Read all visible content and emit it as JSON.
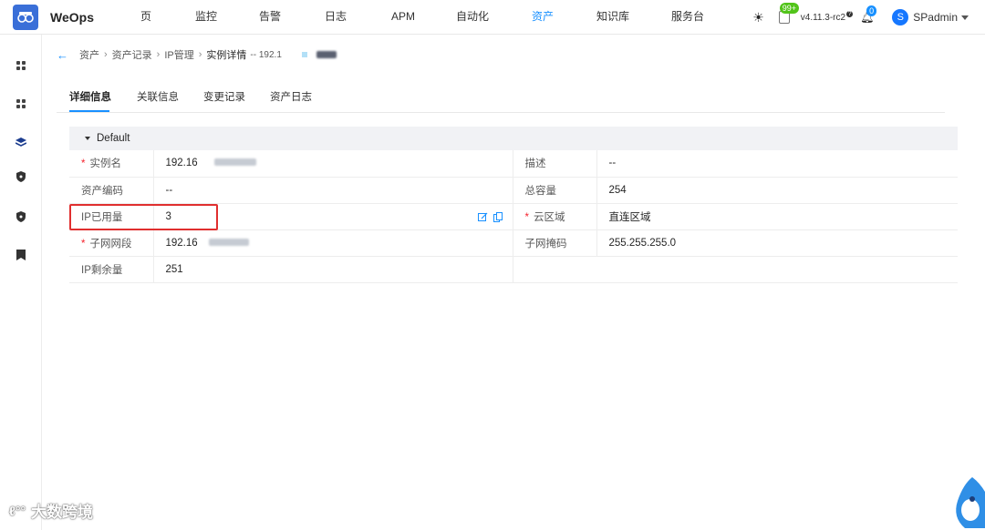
{
  "app": {
    "name": "WeOps",
    "version": "v4.11.3-rc2",
    "user": "SPadmin",
    "user_initial": "S",
    "notice_count": "99+",
    "bell_count": "0"
  },
  "nav": [
    {
      "label": "页",
      "active": false
    },
    {
      "label": "监控",
      "active": false
    },
    {
      "label": "告警",
      "active": false
    },
    {
      "label": "日志",
      "active": false
    },
    {
      "label": "APM",
      "active": false
    },
    {
      "label": "自动化",
      "active": false
    },
    {
      "label": "资产",
      "active": true
    },
    {
      "label": "知识库",
      "active": false
    },
    {
      "label": "服务台",
      "active": false
    }
  ],
  "sidebar": [
    "grid-icon",
    "grid-icon",
    "layers-icon",
    "shield-icon",
    "shield-icon",
    "bookmark-icon"
  ],
  "breadcrumb": {
    "items": [
      "资产",
      "资产记录",
      "IP管理"
    ],
    "current": "实例详情",
    "suffix": "-- 192.1"
  },
  "tabs": [
    "详细信息",
    "关联信息",
    "变更记录",
    "资产日志"
  ],
  "group": {
    "title": "Default",
    "rows": [
      {
        "label": "实例名",
        "required": true,
        "value": "192.16",
        "label2": "描述",
        "required2": false,
        "value2": "--"
      },
      {
        "label": "资产编码",
        "required": false,
        "value": "--",
        "label2": "总容量",
        "required2": false,
        "value2": "254"
      },
      {
        "label": "IP已用量",
        "required": false,
        "value": "3",
        "label2": "云区域",
        "required2": true,
        "value2": "直连区域"
      },
      {
        "label": "子网网段",
        "required": true,
        "value": "192.16",
        "label2": "子网掩码",
        "required2": false,
        "value2": "255.255.255.0"
      },
      {
        "label": "IP剩余量",
        "required": false,
        "value": "251",
        "label2": "",
        "required2": false,
        "value2": ""
      }
    ]
  },
  "watermark": "大数跨境",
  "colors": {
    "accent": "#1890ff",
    "highlight": "#e02f2f",
    "required": "#f5222d"
  }
}
